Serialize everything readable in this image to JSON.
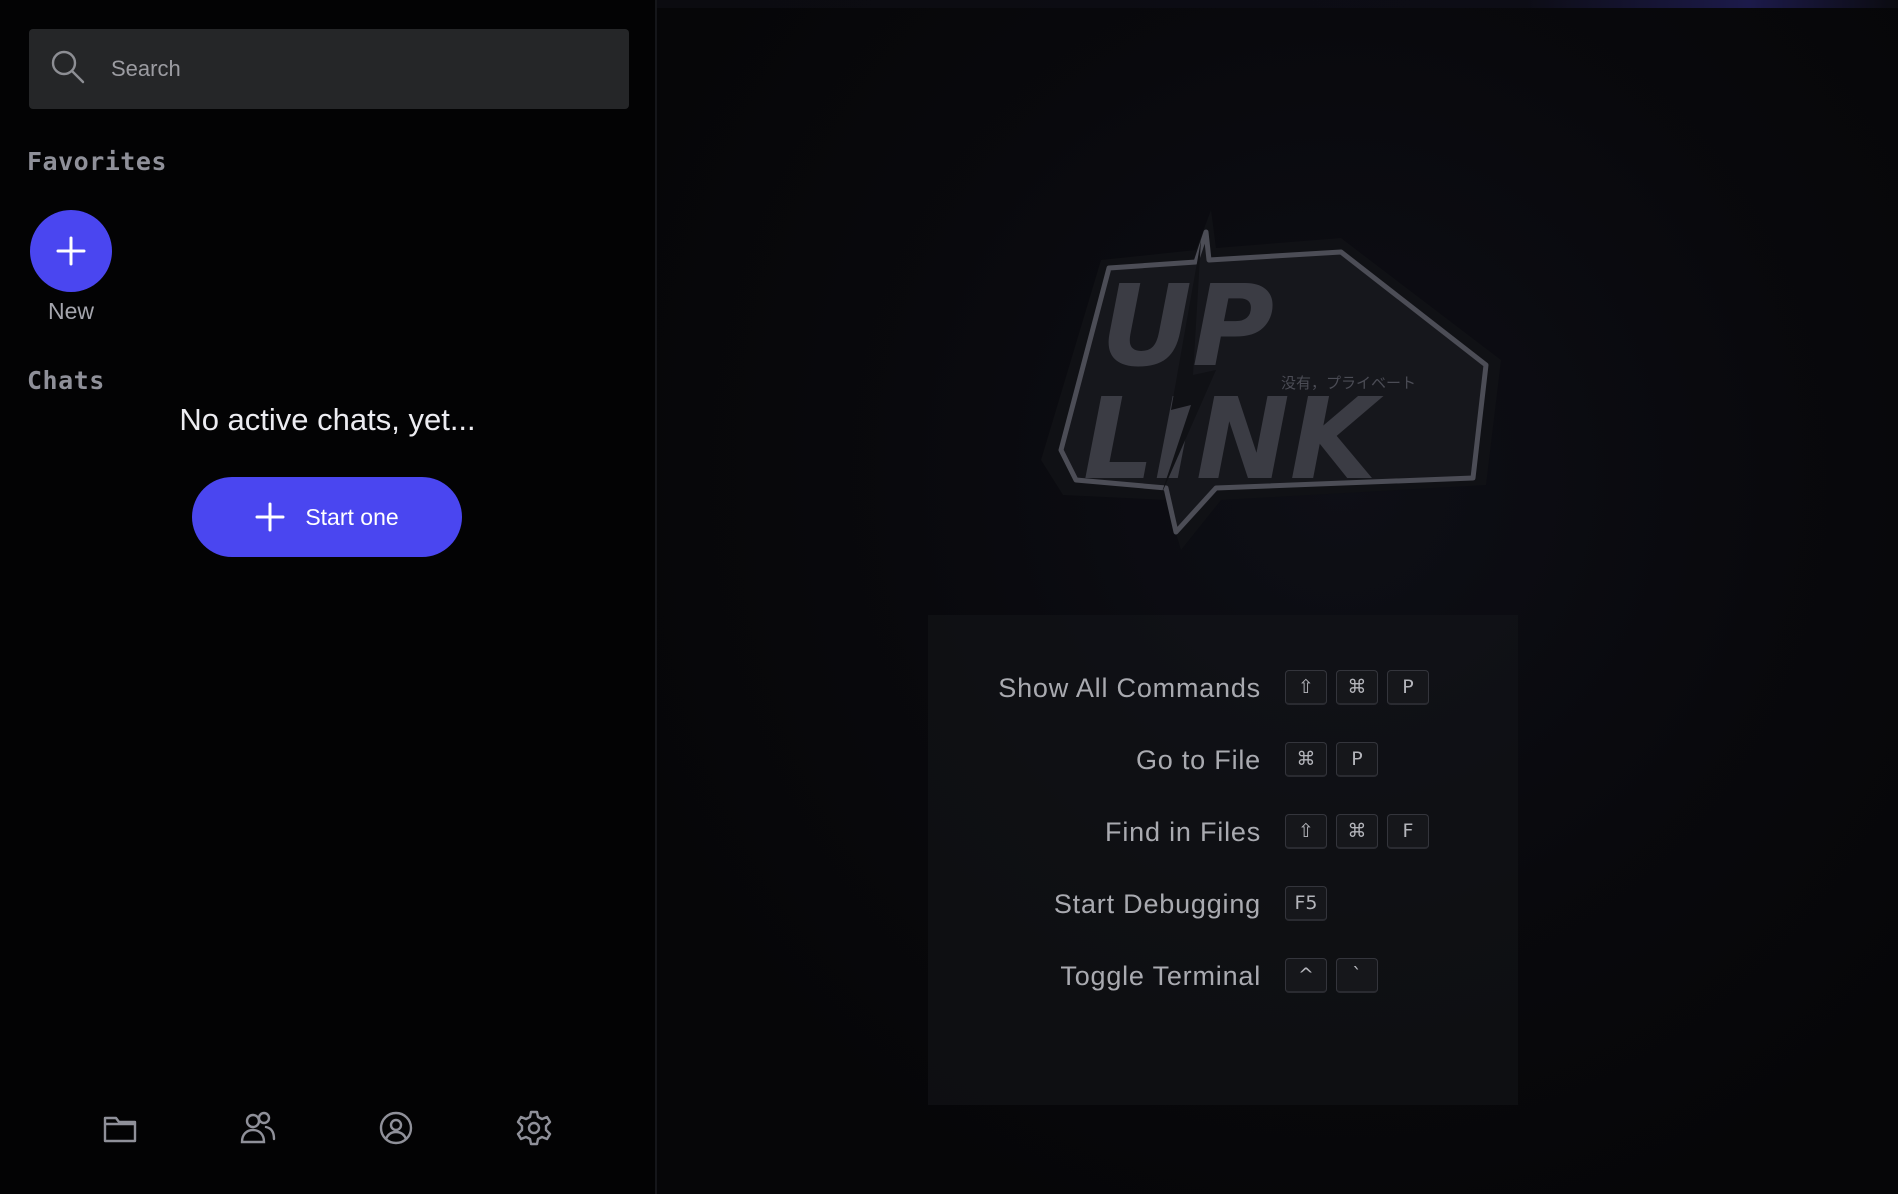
{
  "sidebar": {
    "search": {
      "placeholder": "Search",
      "value": ""
    },
    "favorites": {
      "title": "Favorites",
      "new_label": "New"
    },
    "chats": {
      "title": "Chats",
      "empty_message": "No active chats, yet...",
      "start_button_label": "Start one"
    },
    "footer_icons": [
      "folder-icon",
      "friends-icon",
      "profile-icon",
      "settings-icon"
    ]
  },
  "main": {
    "logo": {
      "line1": "UP",
      "line2": "LINK",
      "tagline": "没有，プライベート"
    },
    "shortcuts": [
      {
        "label": "Show All Commands",
        "keys": [
          "⇧",
          "⌘",
          "P"
        ]
      },
      {
        "label": "Go to File",
        "keys": [
          "⌘",
          "P"
        ]
      },
      {
        "label": "Find in Files",
        "keys": [
          "⇧",
          "⌘",
          "F"
        ]
      },
      {
        "label": "Start Debugging",
        "keys": [
          "F5"
        ]
      },
      {
        "label": "Toggle Terminal",
        "keys": [
          "^",
          "`"
        ]
      }
    ]
  },
  "colors": {
    "accent": "#4a46f0",
    "sidebar_bg": "#030304",
    "search_bg": "#252628",
    "section_title": "#8f9099"
  }
}
